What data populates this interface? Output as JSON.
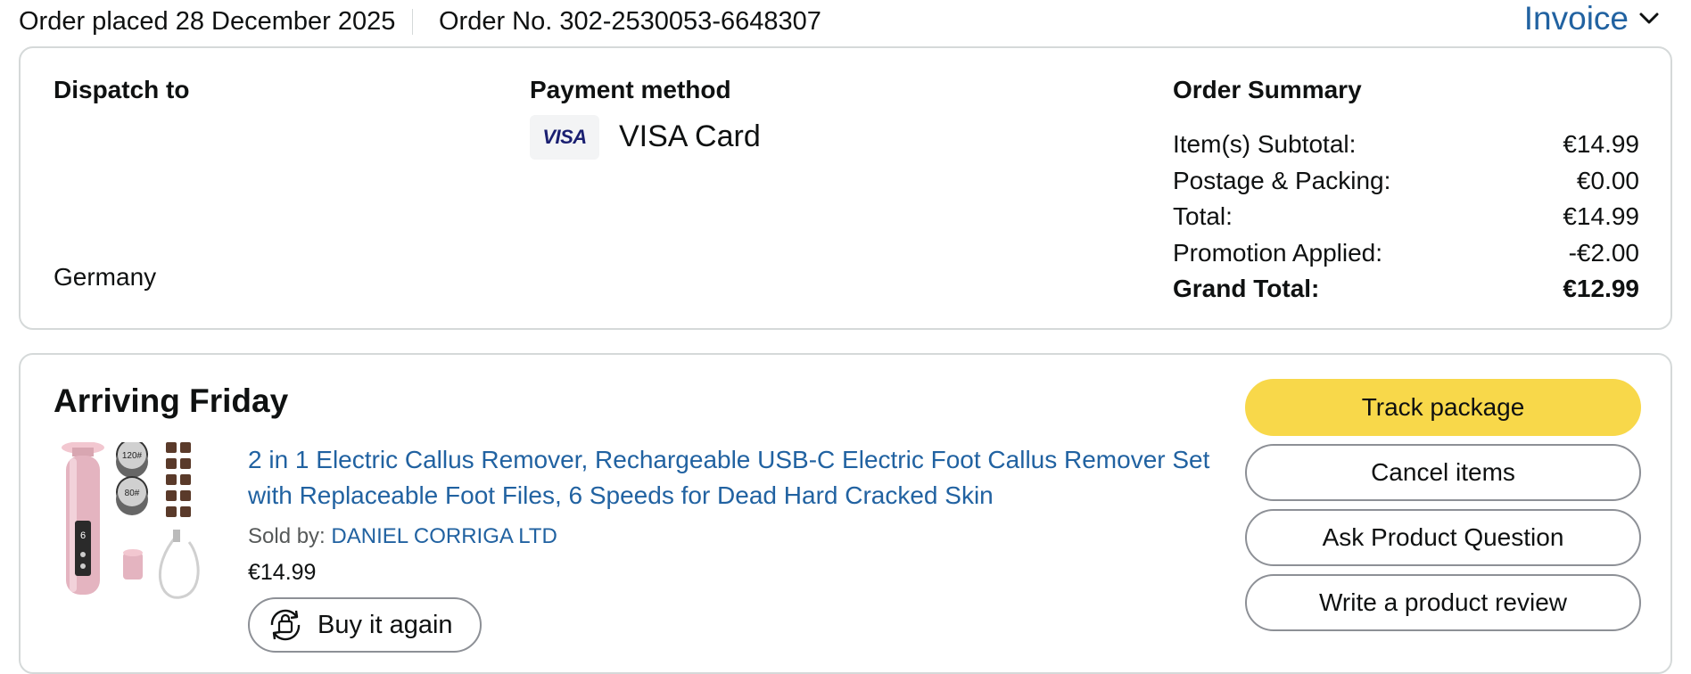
{
  "header": {
    "order_placed": "Order placed 28 December 2025",
    "order_number": "Order No. 302-2530053-6648307",
    "invoice_label": "Invoice"
  },
  "dispatch": {
    "heading": "Dispatch to",
    "country": "Germany"
  },
  "payment": {
    "heading": "Payment method",
    "card_logo_text": "VISA",
    "card_label": "VISA Card"
  },
  "summary": {
    "heading": "Order Summary",
    "rows": [
      {
        "label": "Item(s) Subtotal:",
        "value": "€14.99"
      },
      {
        "label": "Postage & Packing:",
        "value": "€0.00"
      },
      {
        "label": "Total:",
        "value": "€14.99"
      },
      {
        "label": "Promotion Applied:",
        "value": "-€2.00"
      },
      {
        "label": "Grand Total:",
        "value": "€12.99"
      }
    ]
  },
  "shipment": {
    "status": "Arriving Friday",
    "product_title": "2 in 1 Electric Callus Remover, Rechargeable USB-C Electric Foot Callus Remover Set with Replaceable Foot Files, 6 Speeds for Dead Hard Cracked Skin",
    "sold_by_label": "Sold by: ",
    "seller": "DANIEL CORRIGA LTD",
    "price": "€14.99",
    "buy_again_label": "Buy it again",
    "image_labels": [
      "120#",
      "80#",
      "6"
    ]
  },
  "actions": {
    "track": "Track package",
    "cancel": "Cancel items",
    "ask": "Ask Product Question",
    "review": "Write a product review"
  },
  "colors": {
    "link": "#2162a1",
    "primary_button": "#f8d84a",
    "border": "#d5d9d9",
    "product_pink": "#e4b4c0"
  }
}
